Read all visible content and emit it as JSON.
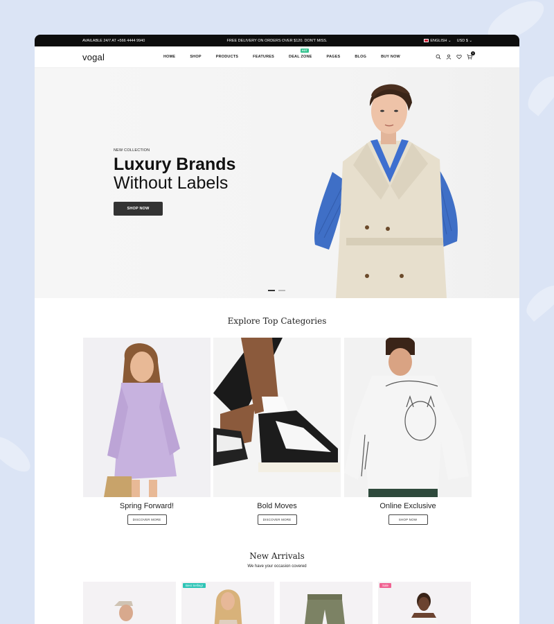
{
  "topbar": {
    "availability": "AVAILABLE 24/7 AT +566 4444 9940",
    "promo": "FREE DELIVERY ON ORDERS OVER $120. DON'T MISS.",
    "language": "ENGLISH",
    "currency": "USD $"
  },
  "nav": {
    "logo": "vogal",
    "items": [
      {
        "label": "HOME"
      },
      {
        "label": "SHOP"
      },
      {
        "label": "PRODUCTS"
      },
      {
        "label": "FEATURES"
      },
      {
        "label": "DEAL ZONE",
        "badge": "HOT"
      },
      {
        "label": "PAGES"
      },
      {
        "label": "BLOG"
      },
      {
        "label": "BUY NOW"
      }
    ],
    "cart_count": "0",
    "icons": [
      "search-icon",
      "user-icon",
      "heart-icon",
      "cart-icon"
    ]
  },
  "hero": {
    "eyebrow": "NEW COLLECTION",
    "title_line1": "Luxury Brands",
    "title_line2": "Without Labels",
    "cta": "SHOP NOW",
    "slide_count": 2,
    "active_slide": 1
  },
  "categories": {
    "title": "Explore Top Categories",
    "items": [
      {
        "label": "Spring Forward!",
        "button": "DISCOVER MORE"
      },
      {
        "label": "Bold Moves",
        "button": "DISCOVER MORE"
      },
      {
        "label": "Online Exclusive",
        "button": "SHOP NOW"
      }
    ]
  },
  "arrivals": {
    "title": "New Arrivals",
    "subtitle": "We have your occasion covered",
    "badges": [
      "",
      "Best Selling!",
      "",
      "Sale"
    ]
  },
  "colors": {
    "topbar_bg": "#0d0d0d",
    "hot_badge": "#34c38f",
    "best_selling_badge": "#2ec4b6",
    "sale_badge": "#f06292",
    "page_bg": "#dbe4f5"
  }
}
